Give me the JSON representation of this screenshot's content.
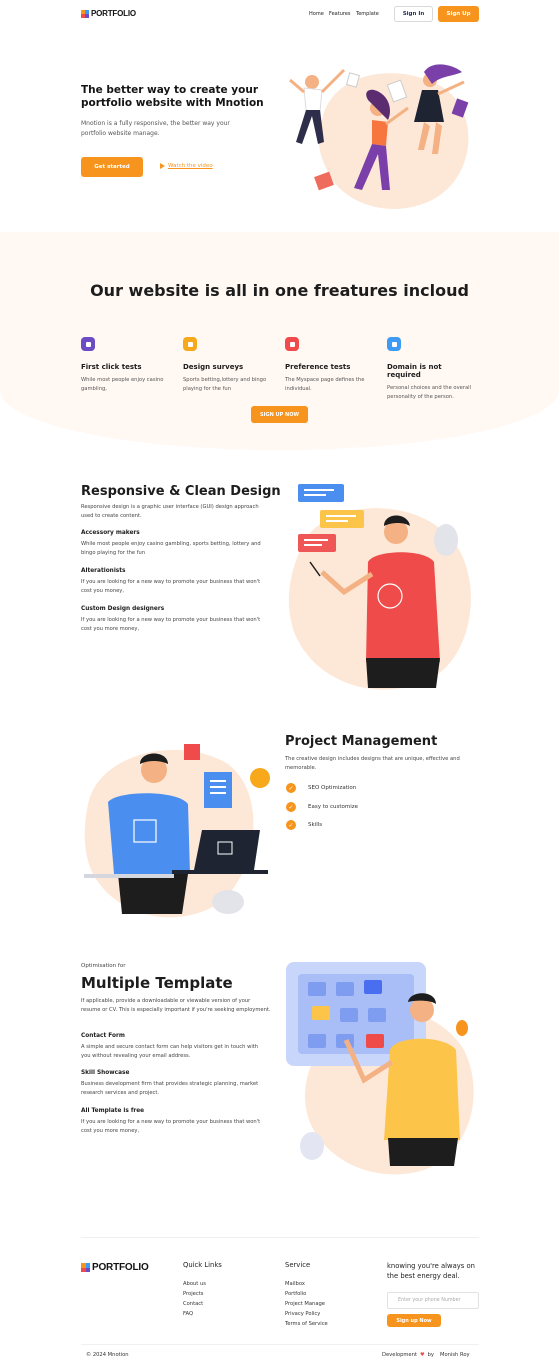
{
  "nav": {
    "logo": "PORTFOLIO",
    "links": [
      "Home",
      "Features",
      "Template"
    ],
    "sign_in": "Sign In",
    "sign_up": "Sign Up"
  },
  "hero": {
    "title": "The better way to create your portfolio website with Mnotion",
    "description": "Mnotion is a fully responsive, the better way your portfolio website manage.",
    "cta": "Get started",
    "watch": "Watch the video"
  },
  "features": {
    "title": "Our website is all in one freatures incloud",
    "items": [
      {
        "title": "First click tests",
        "desc": "While most people enjoy casino gambling,",
        "color": "#6c4cc5",
        "icon": "cursor-icon"
      },
      {
        "title": "Design surveys",
        "desc": "Sports betting,lottery and bingo playing for the fun",
        "color": "#f7a81b",
        "icon": "survey-icon"
      },
      {
        "title": "Preference tests",
        "desc": "The Myspace page defines the individual.",
        "color": "#ef4b4b",
        "icon": "preference-icon"
      },
      {
        "title": "Domain is not required",
        "desc": "Personal choices and the overall personality of the person.",
        "color": "#3d9bf5",
        "icon": "domain-icon"
      }
    ],
    "cta": "SIGN UP NOW"
  },
  "responsive": {
    "title": "Responsive & Clean Design",
    "intro": "Responsive design is a graphic user interface (GUI) design approach used to create content.",
    "items": [
      {
        "title": "Accessory makers",
        "desc": "While most people enjoy casino gambling, sports betting, lottery and bingo playing for the fun"
      },
      {
        "title": "Alterationists",
        "desc": "If you are looking for a new way to promote your business that won't cost you money,"
      },
      {
        "title": "Custom Design designers",
        "desc": "If you are looking for a new way to promote your business that won't cost you more money,"
      }
    ]
  },
  "project": {
    "title": "Project Management",
    "desc": "The creative design includes designs that are unique, effective and memorable.",
    "checks": [
      "SEO Optimization",
      "Easy to customize",
      "Skills"
    ]
  },
  "template": {
    "eyebrow": "Optimisation for",
    "title": "Multiple Template",
    "intro": "If applicable, provide a downloadable or viewable version of your resume or CV. This is especially important if you're seeking employment.",
    "items": [
      {
        "title": "Contact Form",
        "desc": "A simple and secure contact form can help visitors get in touch with you without revealing your email address."
      },
      {
        "title": "Skill Showcase",
        "desc": "Business development firm that provides strategic planning, market research services and project."
      },
      {
        "title": "All Template is free",
        "desc": "If you are looking for a new way to promote your business that won't cost you more money,"
      }
    ]
  },
  "footer": {
    "logo": "PORTFOLIO",
    "quick_links_title": "Quick Links",
    "quick_links": [
      "About us",
      "Projects",
      "Contact",
      "FAQ"
    ],
    "service_title": "Service",
    "service_links": [
      "Mailbox",
      "Portfolio",
      "Project Manage",
      "Privacy Policy",
      "Terms of Service"
    ],
    "newsletter_title": "knowing you're always on the best energy deal.",
    "phone_placeholder": "Enter your phone Number",
    "cta": "Sign up Now",
    "copyright": "© 2024 Mnotion",
    "credit_prefix": "Development",
    "credit_by": "by",
    "credit_name": "Monish Roy"
  },
  "colors": {
    "accent": "#f7941d",
    "peach": "#fde8d8"
  }
}
